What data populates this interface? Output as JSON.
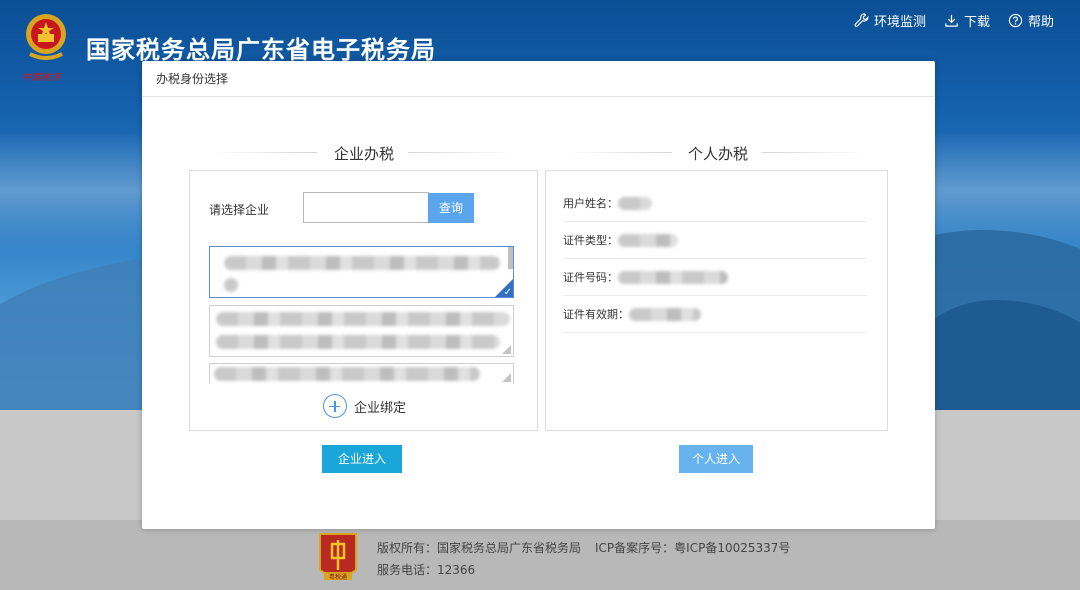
{
  "header": {
    "site_title": "国家税务总局广东省电子税务局",
    "emblem_caption": "中国税务",
    "nav": [
      {
        "label": "环境监测",
        "icon": "wrench-icon"
      },
      {
        "label": "下载",
        "icon": "download-icon"
      },
      {
        "label": "帮助",
        "icon": "help-icon"
      }
    ]
  },
  "modal": {
    "title": "办税身份选择",
    "enterprise": {
      "section_title": "企业办税",
      "select_label": "请选择企业",
      "search_value": "",
      "query_label": "查询",
      "bind_label": "企业绑定",
      "enter_label": "企业进入"
    },
    "personal": {
      "section_title": "个人办税",
      "fields": [
        {
          "label": "用户姓名："
        },
        {
          "label": "证件类型："
        },
        {
          "label": "证件号码："
        },
        {
          "label": "证件有效期："
        }
      ],
      "enter_label": "个人进入"
    }
  },
  "footer": {
    "copyright": "版权所有：国家税务总局广东省税务局",
    "icp": "ICP备案序号：粤ICP备10025337号",
    "phone": "服务电话：12366",
    "logo_caption": "粤税通"
  },
  "colors": {
    "accent": "#5aa5ec",
    "enterprise_button": "#1aa6d8",
    "personal_button": "#66b3f0",
    "selected_border": "#5c8fd6"
  }
}
